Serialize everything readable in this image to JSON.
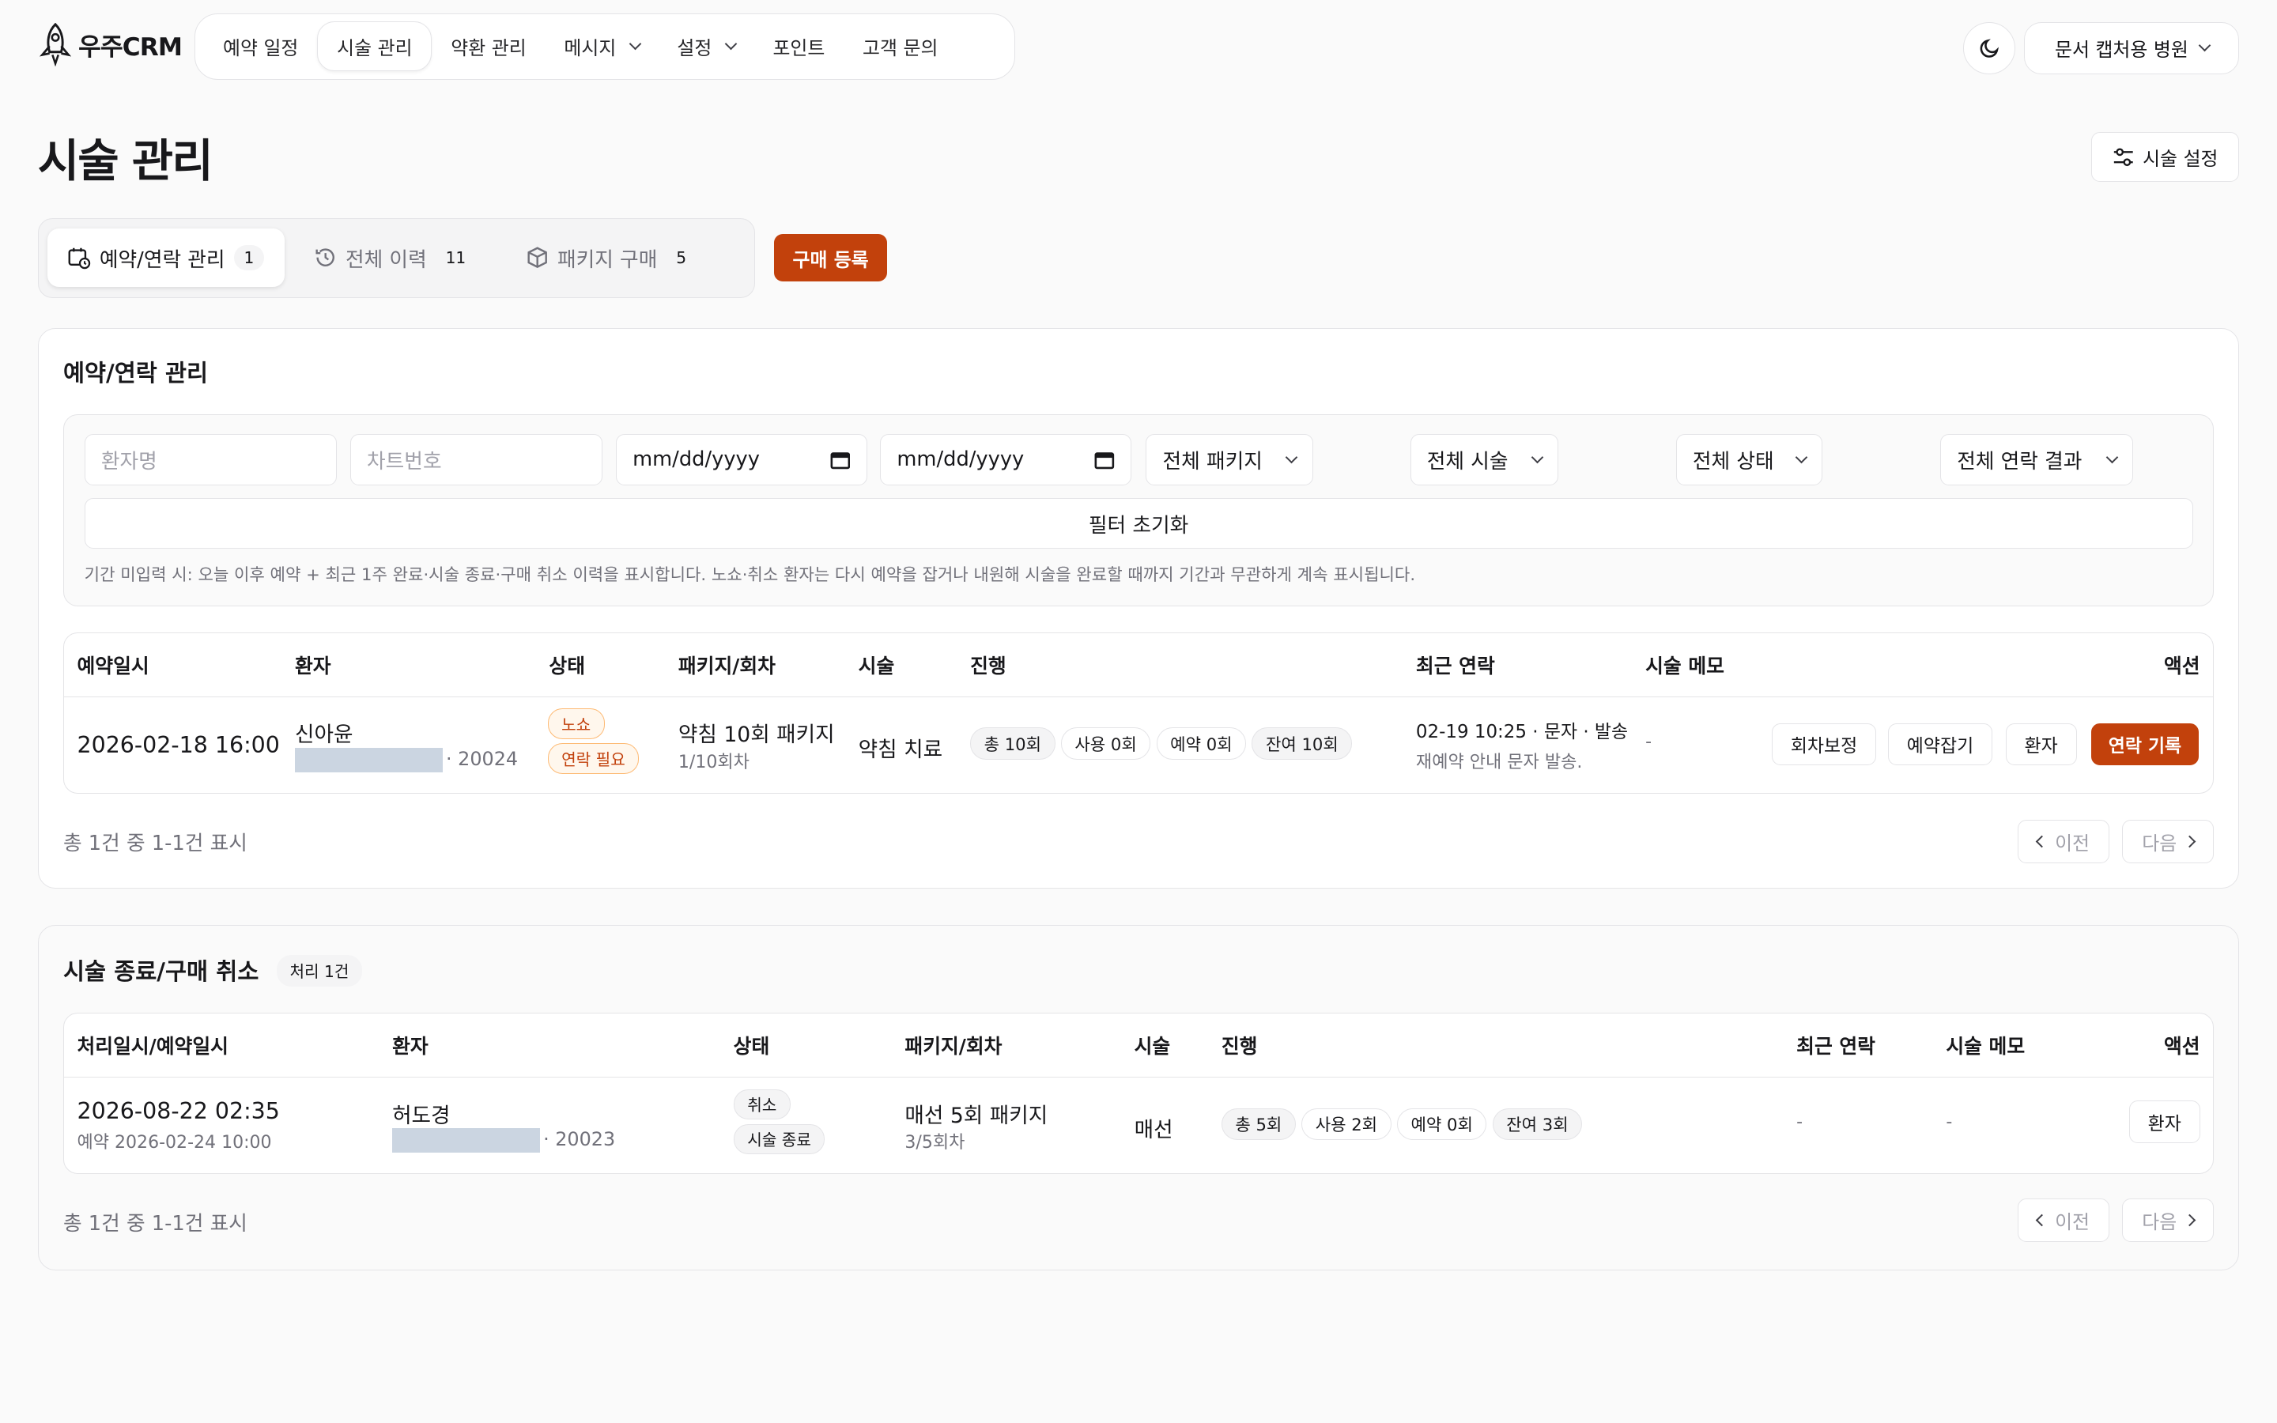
{
  "brand": {
    "name": "우주CRM"
  },
  "nav": {
    "items": [
      {
        "label": "예약 일정",
        "active": false,
        "dropdown": false
      },
      {
        "label": "시술 관리",
        "active": true,
        "dropdown": false
      },
      {
        "label": "약환 관리",
        "active": false,
        "dropdown": false
      },
      {
        "label": "메시지",
        "active": false,
        "dropdown": true
      },
      {
        "label": "설정",
        "active": false,
        "dropdown": true
      },
      {
        "label": "포인트",
        "active": false,
        "dropdown": false
      },
      {
        "label": "고객 문의",
        "active": false,
        "dropdown": false
      }
    ],
    "clinic": "문서 캡처용 병원"
  },
  "page": {
    "title": "시술 관리",
    "settings_label": "시술 설정"
  },
  "tabs": [
    {
      "label": "예약/연락 관리",
      "count": "1",
      "icon": "calendar-clock-icon"
    },
    {
      "label": "전체 이력",
      "count": "11",
      "icon": "history-icon"
    },
    {
      "label": "패키지 구매",
      "count": "5",
      "icon": "box-icon"
    }
  ],
  "buy_label": "구매 등록",
  "section1": {
    "title": "예약/연락 관리",
    "filters": {
      "patient_placeholder": "환자명",
      "chart_placeholder": "차트번호",
      "date_from": "mm/dd/yyyy",
      "date_to": "mm/dd/yyyy",
      "package": "전체 패키지",
      "procedure": "전체 시술",
      "status": "전체 상태",
      "contact_result": "전체 연락 결과",
      "reset": "필터 초기화"
    },
    "hint": "기간 미입력 시: 오늘 이후 예약 + 최근 1주 완료·시술 종료·구매 취소 이력을 표시합니다. 노쇼·취소 환자는 다시 예약을 잡거나 내원해 시술을 완료할 때까지 기간과 무관하게 계속 표시됩니다.",
    "headers": [
      "예약일시",
      "환자",
      "상태",
      "패키지/회차",
      "시술",
      "진행",
      "최근 연락",
      "시술 메모",
      "액션"
    ],
    "row": {
      "datetime": "2026-02-18 16:00",
      "patient": "신아윤",
      "chart_suffix": "· 20024",
      "status1": "노쇼",
      "status2": "연락 필요",
      "package": "약침 10회 패키지",
      "round": "1/10회차",
      "procedure": "약침 치료",
      "chips": [
        "총 10회",
        "사용 0회",
        "예약 0회",
        "잔여 10회"
      ],
      "contact_line1": "02-19 10:25 · 문자 · 발송",
      "contact_line2": "재예약 안내 문자 발송.",
      "memo": "-",
      "actions": [
        "회차보정",
        "예약잡기",
        "환자",
        "연락 기록"
      ]
    },
    "pagination": {
      "info": "총 1건 중 1-1건 표시",
      "prev": "이전",
      "next": "다음"
    }
  },
  "section2": {
    "title": "시술 종료/구매 취소",
    "badge": "처리 1건",
    "headers": [
      "처리일시/예약일시",
      "환자",
      "상태",
      "패키지/회차",
      "시술",
      "진행",
      "최근 연락",
      "시술 메모",
      "액션"
    ],
    "row": {
      "datetime": "2026-08-22 02:35",
      "reservation": "예약 2026-02-24 10:00",
      "patient": "허도경",
      "chart_suffix": "· 20023",
      "status1": "취소",
      "status2": "시술 종료",
      "package": "매선 5회 패키지",
      "round": "3/5회차",
      "procedure": "매선",
      "chips": [
        "총 5회",
        "사용 2회",
        "예약 0회",
        "잔여 3회"
      ],
      "contact": "-",
      "memo": "-",
      "action": "환자"
    },
    "pagination": {
      "info": "총 1건 중 1-1건 표시",
      "prev": "이전",
      "next": "다음"
    }
  }
}
